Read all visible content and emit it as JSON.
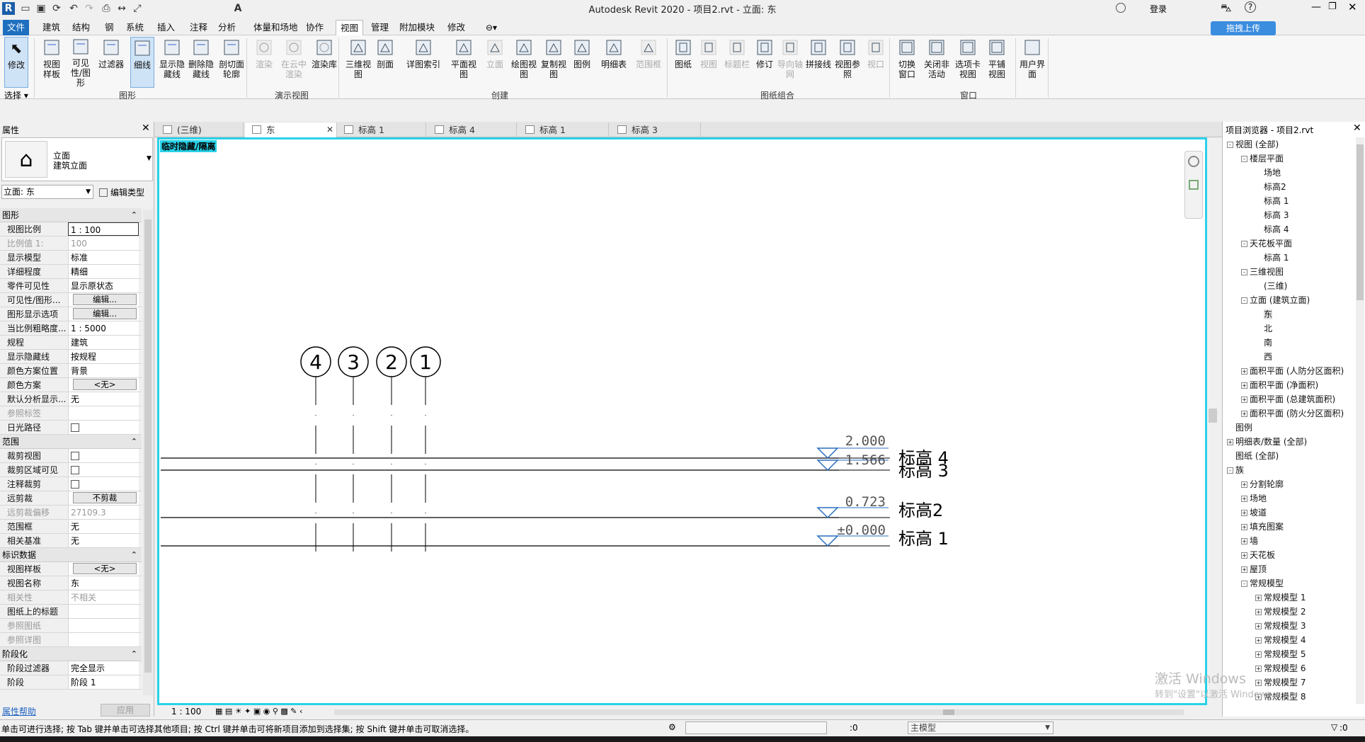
{
  "window": {
    "title": "Autodesk Revit 2020 - 项目2.rvt - 立面: 东",
    "login": "登录",
    "upload_btn": "拖拽上传"
  },
  "menu": [
    "文件",
    "建筑",
    "结构",
    "钢",
    "系统",
    "插入",
    "注释",
    "分析",
    "体量和场地",
    "协作",
    "视图",
    "管理",
    "附加模块",
    "修改"
  ],
  "menu_active": "视图",
  "ribbon": {
    "modify": "修改",
    "select": "选择",
    "graphics": [
      "视图样板",
      "可见性/图形",
      "过滤器",
      "细线",
      "显示隐藏线",
      "删除隐藏线",
      "剖切面轮廓"
    ],
    "graphics_label": "图形",
    "present": [
      "渲染",
      "在云中渲染",
      "渲染库"
    ],
    "present_label": "演示视图",
    "create": [
      "三维视图",
      "剖面",
      "详图索引",
      "平面视图",
      "立面",
      "绘图视图",
      "复制视图",
      "图例",
      "明细表",
      "范围框"
    ],
    "create_label": "创建",
    "sheet": [
      "图纸",
      "视图",
      "标题栏",
      "修订",
      "导向轴网",
      "拼接线",
      "视图参照",
      "视口"
    ],
    "sheet_label": "图纸组合",
    "window_group": [
      "切换窗口",
      "关闭非活动",
      "选项卡视图",
      "平铺视图"
    ],
    "window_label": "窗口",
    "ui": "用户界面"
  },
  "tabs": [
    "(三维)",
    "东",
    "标高 1",
    "标高 4",
    "标高 1",
    "标高 3"
  ],
  "properties": {
    "title": "属性",
    "type_line1": "立面",
    "type_line2": "建筑立面",
    "selector": "立面: 东",
    "edit_type": "编辑类型",
    "sections": [
      {
        "name": "图形",
        "rows": [
          [
            "视图比例",
            "1 : 100"
          ],
          [
            "比例值 1:",
            "100"
          ],
          [
            "显示模型",
            "标准"
          ],
          [
            "详细程度",
            "精细"
          ],
          [
            "零件可见性",
            "显示原状态"
          ],
          [
            "可见性/图形...",
            "编辑..."
          ],
          [
            "图形显示选项",
            "编辑..."
          ],
          [
            "当比例粗略度...",
            "1 : 5000"
          ],
          [
            "规程",
            "建筑"
          ],
          [
            "显示隐藏线",
            "按规程"
          ],
          [
            "颜色方案位置",
            "背景"
          ],
          [
            "颜色方案",
            "<无>"
          ],
          [
            "默认分析显示...",
            "无"
          ],
          [
            "参照标签",
            ""
          ],
          [
            "日光路径",
            ""
          ]
        ]
      },
      {
        "name": "范围",
        "rows": [
          [
            "裁剪视图",
            ""
          ],
          [
            "裁剪区域可见",
            ""
          ],
          [
            "注释裁剪",
            ""
          ],
          [
            "远剪裁",
            "不剪裁"
          ],
          [
            "远剪裁偏移",
            "27109.3"
          ],
          [
            "范围框",
            "无"
          ],
          [
            "相关基准",
            "无"
          ]
        ]
      },
      {
        "name": "标识数据",
        "rows": [
          [
            "视图样板",
            "<无>"
          ],
          [
            "视图名称",
            "东"
          ],
          [
            "相关性",
            "不相关"
          ],
          [
            "图纸上的标题",
            ""
          ],
          [
            "参照图纸",
            ""
          ],
          [
            "参照详图",
            ""
          ]
        ]
      },
      {
        "name": "阶段化",
        "rows": [
          [
            "阶段过滤器",
            "完全显示"
          ],
          [
            "阶段",
            "阶段 1"
          ]
        ]
      }
    ],
    "help": "属性帮助",
    "apply": "应用"
  },
  "canvas": {
    "hidden_label": "临时隐藏/隔离",
    "grids": [
      "4",
      "3",
      "2",
      "1"
    ],
    "levels": [
      {
        "value": "2.000",
        "name": "标高 4"
      },
      {
        "value": "1.566",
        "name": "标高 3"
      },
      {
        "value": "0.723",
        "name": "标高2"
      },
      {
        "value": "±0.000",
        "name": "标高 1"
      }
    ],
    "scale": "1 : 100"
  },
  "browser": {
    "title": "项目浏览器 - 项目2.rvt",
    "nodes": [
      [
        "视图 (全部)",
        0,
        "-"
      ],
      [
        "楼层平面",
        1,
        "-"
      ],
      [
        "场地",
        2,
        ""
      ],
      [
        "标高2",
        2,
        ""
      ],
      [
        "标高 1",
        2,
        ""
      ],
      [
        "标高 3",
        2,
        ""
      ],
      [
        "标高 4",
        2,
        ""
      ],
      [
        "天花板平面",
        1,
        "-"
      ],
      [
        "标高 1",
        2,
        ""
      ],
      [
        "三维视图",
        1,
        "-"
      ],
      [
        "(三维)",
        2,
        ""
      ],
      [
        "立面 (建筑立面)",
        1,
        "-"
      ],
      [
        "东",
        2,
        ""
      ],
      [
        "北",
        2,
        ""
      ],
      [
        "南",
        2,
        ""
      ],
      [
        "西",
        2,
        ""
      ],
      [
        "面积平面 (人防分区面积)",
        1,
        "+"
      ],
      [
        "面积平面 (净面积)",
        1,
        "+"
      ],
      [
        "面积平面 (总建筑面积)",
        1,
        "+"
      ],
      [
        "面积平面 (防火分区面积)",
        1,
        "+"
      ],
      [
        "图例",
        0,
        ""
      ],
      [
        "明细表/数量 (全部)",
        0,
        "+"
      ],
      [
        "图纸 (全部)",
        0,
        ""
      ],
      [
        "族",
        0,
        "-"
      ],
      [
        "分割轮廓",
        1,
        "+"
      ],
      [
        "场地",
        1,
        "+"
      ],
      [
        "坡道",
        1,
        "+"
      ],
      [
        "填充图案",
        1,
        "+"
      ],
      [
        "墙",
        1,
        "+"
      ],
      [
        "天花板",
        1,
        "+"
      ],
      [
        "屋顶",
        1,
        "+"
      ],
      [
        "常规模型",
        1,
        "-"
      ],
      [
        "常规模型 1",
        2,
        "+"
      ],
      [
        "常规模型 2",
        2,
        "+"
      ],
      [
        "常规模型 3",
        2,
        "+"
      ],
      [
        "常规模型 4",
        2,
        "+"
      ],
      [
        "常规模型 5",
        2,
        "+"
      ],
      [
        "常规模型 6",
        2,
        "+"
      ],
      [
        "常规模型 7",
        2,
        "+"
      ],
      [
        "常规模型 8",
        2,
        "+"
      ]
    ],
    "watermark1": "激活 Windows",
    "watermark2": "转到\"设置\"以激活 Windows。"
  },
  "status": {
    "text": "单击可进行选择; 按 Tab 键并单击可选择其他项目; 按 Ctrl 键并单击可将新项目添加到选择集; 按 Shift 键并单击可取消选择。",
    "zero": ":0",
    "model": "主模型",
    "filter": ":0"
  }
}
